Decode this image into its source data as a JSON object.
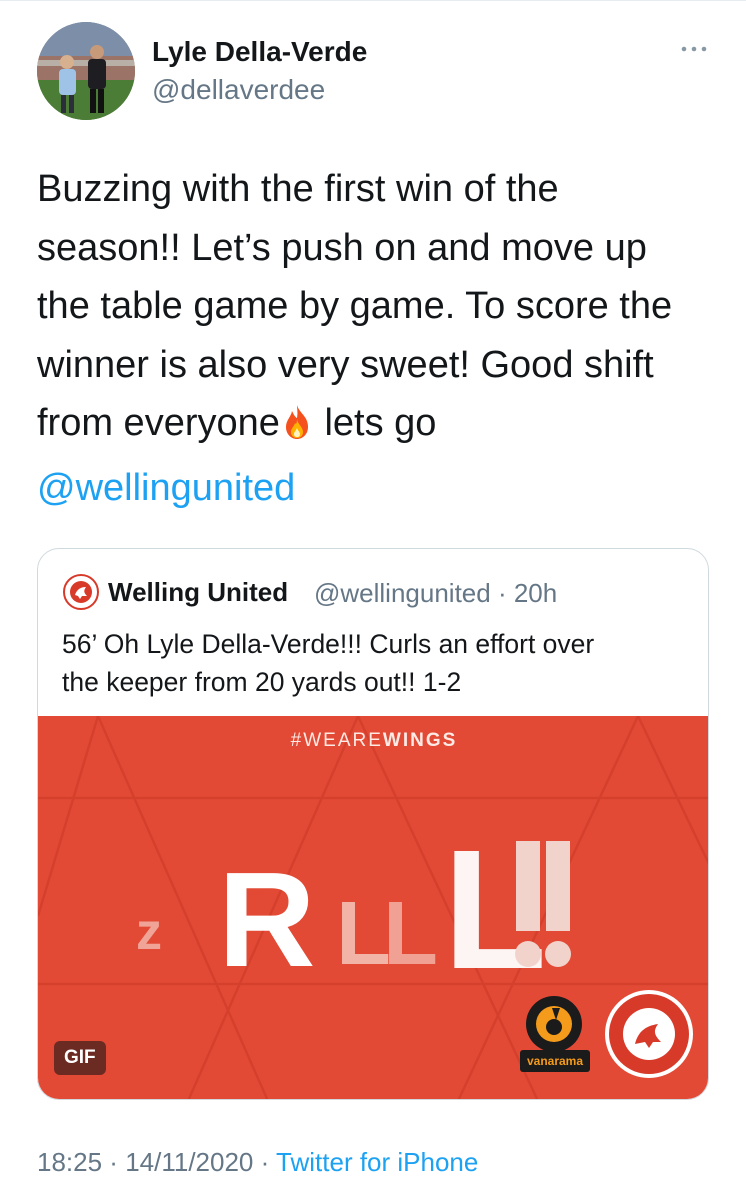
{
  "author": {
    "name": "Lyle Della-Verde",
    "handle": "@dellaverdee"
  },
  "tweet": {
    "lines": [
      "Buzzing with the first win of the",
      "season!! Let’s push on and move up",
      "the table game by game. To score the",
      "winner is also very sweet! Good shift"
    ],
    "line5_before_emoji": "from everyone",
    "emoji": "fire-emoji",
    "line5_after_emoji": " lets go",
    "mention": "@wellingunited"
  },
  "quoted_tweet": {
    "name": "Welling United",
    "handle": "@wellingunited",
    "separator": " · ",
    "time": "20h",
    "lines": [
      "56’ Oh Lyle Della-Verde!!! Curls an effort over",
      "the keeper from 20 yards out!! 1-2"
    ],
    "media": {
      "hashtag_prefix": "#WEARE",
      "hashtag_bold": "WINGS",
      "gif_label": "GIF",
      "background_color": "#e24a35",
      "sponsor_logo": "vanarama-national-league-logo",
      "club_logo": "welling-united-football-club-badge"
    }
  },
  "meta": {
    "time": "18:25",
    "separator": " · ",
    "date": "14/11/2020",
    "separator2": " · ",
    "source": "Twitter for iPhone"
  }
}
